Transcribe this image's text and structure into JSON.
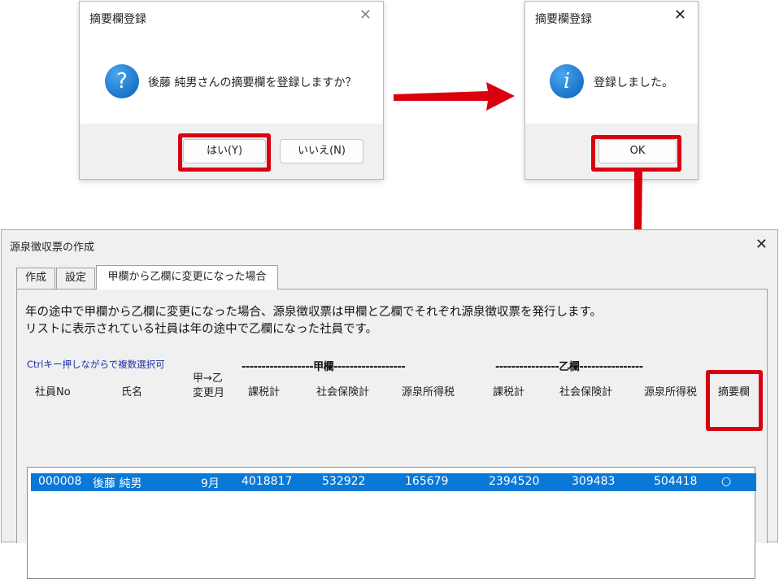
{
  "confirm_dialog": {
    "title": "摘要欄登録",
    "close_label": "✕",
    "icon_glyph": "?",
    "message": "後藤 純男さんの摘要欄を登録しますか？",
    "yes_label": "はい(Y)",
    "no_label": "いいえ(N)"
  },
  "info_dialog": {
    "title": "摘要欄登録",
    "close_label": "✕",
    "icon_glyph": "i",
    "message": "登録しました。",
    "ok_label": "OK"
  },
  "main_window": {
    "title": "源泉徴収票の作成",
    "close_label": "✕",
    "tabs": [
      {
        "label": "作成"
      },
      {
        "label": "設定"
      },
      {
        "label": "甲欄から乙欄に変更になった場合"
      }
    ],
    "description_line1": "年の途中で甲欄から乙欄に変更になった場合、源泉徴収票は甲欄と乙欄でそれぞれ源泉徴収票を発行します。",
    "description_line2": "リストに表示されている社員は年の途中で乙欄になった社員です。",
    "ctrl_note": "Ctrlキー押しながらで複数選択可",
    "group_ko": "------------------甲欄------------------",
    "group_otsu": "----------------乙欄----------------",
    "columns": {
      "employee_no": "社員No",
      "name": "氏名",
      "change_month_line1": "甲→乙",
      "change_month_line2": "変更月",
      "ko_taxable": "課税計",
      "ko_social": "社会保険計",
      "ko_withholding": "源泉所得税",
      "otsu_taxable": "課税計",
      "otsu_social": "社会保険計",
      "otsu_withholding": "源泉所得税",
      "summary": "摘要欄"
    },
    "rows": [
      {
        "employee_no": "000008",
        "name": "後藤 純男",
        "change_month": "9月",
        "ko_taxable": "4018817",
        "ko_social": "532922",
        "ko_withholding": "165679",
        "otsu_taxable": "2394520",
        "otsu_social": "309483",
        "otsu_withholding": "504418",
        "summary": "○"
      }
    ]
  },
  "colors": {
    "highlight": "#d90010",
    "selection": "#0a78d7",
    "icon_blue": "#1a74c9",
    "note_blue": "#1b2fa0"
  }
}
